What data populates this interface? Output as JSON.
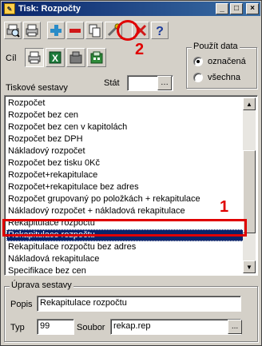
{
  "window": {
    "title": "Tisk: Rozpočty",
    "controls": {
      "minimize": "_",
      "maximize": "□",
      "close": "×"
    }
  },
  "toolbar": {
    "tools": [
      {
        "name": "preview",
        "icon": "print-preview-icon"
      },
      {
        "name": "print",
        "icon": "printer-icon"
      },
      {
        "name": "add",
        "icon": "plus-icon"
      },
      {
        "name": "remove",
        "icon": "minus-icon"
      },
      {
        "name": "copy",
        "icon": "copy-icon"
      },
      {
        "name": "edit",
        "icon": "wrench-icon"
      },
      {
        "name": "cancel",
        "icon": "red-x-icon"
      },
      {
        "name": "help",
        "icon": "question-icon"
      }
    ]
  },
  "annotations": {
    "one": "1",
    "two": "2",
    "color": "#e00000"
  },
  "target": {
    "label": "Cíl",
    "options": [
      "printer-icon",
      "excel-icon",
      "fax-icon",
      "export-icon"
    ]
  },
  "use_data": {
    "legend": "Použít data",
    "options": [
      {
        "label": "označená",
        "checked": true
      },
      {
        "label": "všechna",
        "checked": false
      }
    ]
  },
  "reports": {
    "label": "Tiskové sestavy",
    "state_label": "Stát",
    "state_value": "",
    "items": [
      "Rozpočet",
      "Rozpočet bez cen",
      "Rozpočet bez cen v kapitolách",
      "Rozpočet bez DPH",
      "Nákladový rozpočet",
      "Rozpočet bez tisku 0Kč",
      "Rozpočet+rekapitulace",
      "Rozpočet+rekapitulace bez adres",
      "Rozpočet grupovaný po položkách + rekapitulace",
      "Nákladový rozpočet + nákladová rekapitulace",
      "Rekapitulace rozpočtu",
      "Rekapitulace rozpočtu",
      "Rekapitulace rozpočtu bez adres",
      "Nákladová rekapitulace",
      "Specifikace bez cen"
    ],
    "selected_index": 11
  },
  "edit": {
    "legend": "Úprava sestavy",
    "description_label": "Popis",
    "description_value": "Rekapitulace rozpočtu",
    "type_label": "Typ",
    "type_value": "99",
    "file_label": "Soubor",
    "file_value": "rekap.rep",
    "browse_label": "..."
  },
  "accent": "#0a246a"
}
